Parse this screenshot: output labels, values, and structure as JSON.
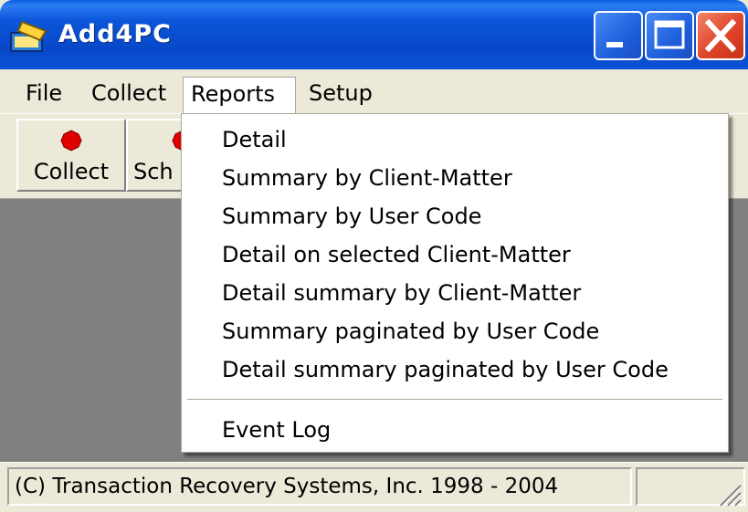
{
  "window": {
    "title": "Add4PC",
    "icon": "app-icon",
    "controls": [
      "minimize-icon",
      "maximize-icon",
      "close-icon"
    ]
  },
  "menubar": {
    "items": [
      {
        "label": "File"
      },
      {
        "label": "Collect"
      },
      {
        "label": "Reports"
      },
      {
        "label": "Setup"
      }
    ],
    "active": "Reports"
  },
  "toolbar": {
    "buttons": [
      {
        "label": "Collect",
        "icon": "red-dot-icon"
      },
      {
        "label": "Sch",
        "icon": "red-dot-icon"
      }
    ]
  },
  "reports_menu": {
    "items": [
      {
        "label": "Detail"
      },
      {
        "label": "Summary by Client-Matter"
      },
      {
        "label": "Summary by User Code"
      },
      {
        "label": "Detail on selected Client-Matter"
      },
      {
        "label": "Detail summary by Client-Matter"
      },
      {
        "label": "Summary paginated by User Code"
      },
      {
        "label": "Detail summary paginated by User Code"
      },
      {
        "label": "Event Log"
      }
    ]
  },
  "statusbar": {
    "text": "(C) Transaction Recovery Systems, Inc. 1998 - 2004"
  },
  "colors": {
    "titlebar": "#0848c8",
    "close_button": "#e0442a",
    "client_area": "#808080",
    "chrome": "#ece9d8",
    "record_dot": "#e00000"
  }
}
